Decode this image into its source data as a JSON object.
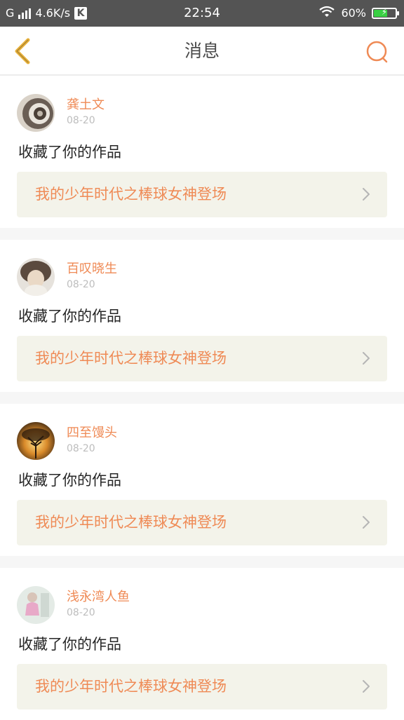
{
  "status_bar": {
    "network": "G",
    "speed": "4.6K/s",
    "carrier_badge": "K",
    "time": "22:54",
    "battery": "60%",
    "battery_level": 0.6
  },
  "header": {
    "title": "消息",
    "back_icon": "chevron-left-icon",
    "search_icon": "search-icon"
  },
  "colors": {
    "accent": "#ef8a55",
    "back_icon": "#e8b13a",
    "card_link_bg": "#f3f3ea"
  },
  "messages": [
    {
      "username": "龚土文",
      "date": "08-20",
      "action": "收藏了你的作品",
      "work_title": "我的少年时代之棒球女神登场"
    },
    {
      "username": "百叹晓生",
      "date": "08-20",
      "action": "收藏了你的作品",
      "work_title": "我的少年时代之棒球女神登场"
    },
    {
      "username": "四至馒头",
      "date": "08-20",
      "action": "收藏了你的作品",
      "work_title": "我的少年时代之棒球女神登场"
    },
    {
      "username": "浅永湾人鱼",
      "date": "08-20",
      "action": "收藏了你的作品",
      "work_title": "我的少年时代之棒球女神登场"
    }
  ]
}
